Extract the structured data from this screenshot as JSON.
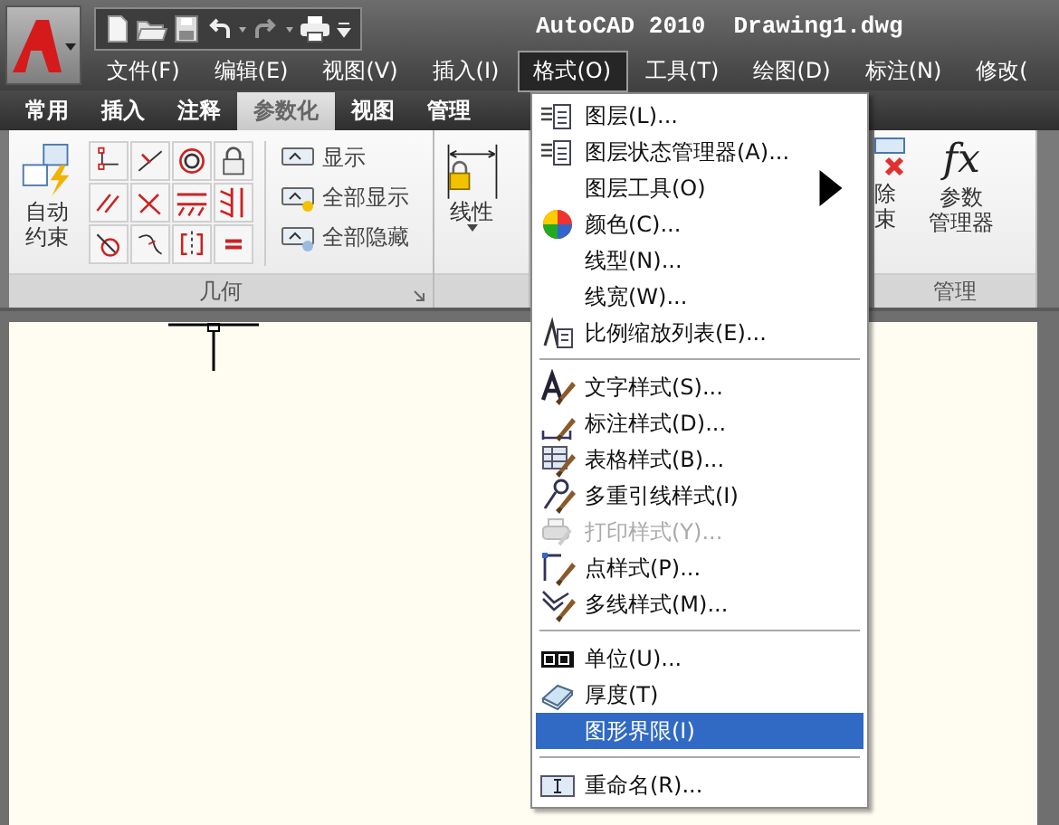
{
  "title_bar": {
    "title": "AutoCAD 2010  Drawing1.dwg"
  },
  "menu_bar": [
    {
      "label": "文件(F)",
      "selected": false
    },
    {
      "label": "编辑(E)",
      "selected": false
    },
    {
      "label": "视图(V)",
      "selected": false
    },
    {
      "label": "插入(I)",
      "selected": false
    },
    {
      "label": "格式(O)",
      "selected": true
    },
    {
      "label": "工具(T)",
      "selected": false
    },
    {
      "label": "绘图(D)",
      "selected": false
    },
    {
      "label": "标注(N)",
      "selected": false
    },
    {
      "label": "修改(",
      "selected": false
    }
  ],
  "ribbon_tabs": [
    {
      "label": "常用",
      "selected": false
    },
    {
      "label": "插入",
      "selected": false
    },
    {
      "label": "注释",
      "selected": false
    },
    {
      "label": "参数化",
      "selected": true
    },
    {
      "label": "视图",
      "selected": false
    },
    {
      "label": "管理",
      "selected": false
    }
  ],
  "geometry_panel": {
    "title": "几何",
    "auto_constrain": [
      "自动",
      "约束"
    ],
    "display_buttons": [
      "显示",
      "全部显示",
      "全部隐藏"
    ]
  },
  "dimension_panel": {
    "linear_button": "线性"
  },
  "manage_panel": {
    "title": "管理",
    "partial_button": [
      "除",
      "束"
    ],
    "parameters_icon": "fx",
    "parameters_button": [
      "参数",
      "管理器"
    ]
  },
  "format_menu": [
    {
      "kind": "item",
      "label": "图层(L)...",
      "submenu": false,
      "disabled": false,
      "selected": false
    },
    {
      "kind": "item",
      "label": "图层状态管理器(A)...",
      "submenu": false,
      "disabled": false,
      "selected": false
    },
    {
      "kind": "item",
      "label": "图层工具(O)",
      "submenu": true,
      "disabled": false,
      "selected": false
    },
    {
      "kind": "item",
      "label": "颜色(C)...",
      "submenu": false,
      "disabled": false,
      "selected": false
    },
    {
      "kind": "item",
      "label": "线型(N)...",
      "submenu": false,
      "disabled": false,
      "selected": false
    },
    {
      "kind": "item",
      "label": "线宽(W)...",
      "submenu": false,
      "disabled": false,
      "selected": false
    },
    {
      "kind": "item",
      "label": "比例缩放列表(E)...",
      "submenu": false,
      "disabled": false,
      "selected": false
    },
    {
      "kind": "separator"
    },
    {
      "kind": "item",
      "label": "文字样式(S)...",
      "submenu": false,
      "disabled": false,
      "selected": false
    },
    {
      "kind": "item",
      "label": "标注样式(D)...",
      "submenu": false,
      "disabled": false,
      "selected": false
    },
    {
      "kind": "item",
      "label": "表格样式(B)...",
      "submenu": false,
      "disabled": false,
      "selected": false
    },
    {
      "kind": "item",
      "label": "多重引线样式(I)",
      "submenu": false,
      "disabled": false,
      "selected": false
    },
    {
      "kind": "item",
      "label": "打印样式(Y)...",
      "submenu": false,
      "disabled": true,
      "selected": false
    },
    {
      "kind": "item",
      "label": "点样式(P)...",
      "submenu": false,
      "disabled": false,
      "selected": false
    },
    {
      "kind": "item",
      "label": "多线样式(M)...",
      "submenu": false,
      "disabled": false,
      "selected": false
    },
    {
      "kind": "separator"
    },
    {
      "kind": "item",
      "label": "单位(U)...",
      "submenu": false,
      "disabled": false,
      "selected": false
    },
    {
      "kind": "item",
      "label": "厚度(T)",
      "submenu": false,
      "disabled": false,
      "selected": false
    },
    {
      "kind": "item",
      "label": "图形界限(I)",
      "submenu": false,
      "disabled": false,
      "selected": true
    },
    {
      "kind": "separator"
    },
    {
      "kind": "item",
      "label": "重命名(R)...",
      "submenu": false,
      "disabled": false,
      "selected": false
    }
  ]
}
